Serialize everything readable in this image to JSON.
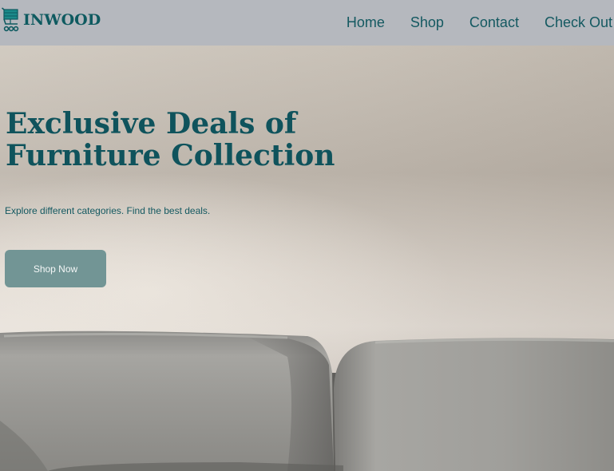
{
  "brand": {
    "name": "INWOOD",
    "icon": "shopping-cart-icon",
    "color": "#0e5a60"
  },
  "nav": {
    "items": [
      {
        "label": "Home"
      },
      {
        "label": "Shop"
      },
      {
        "label": "Contact"
      },
      {
        "label": "Check Out"
      }
    ]
  },
  "hero": {
    "title_line1": "Exclusive Deals of",
    "title_line2": "Furniture Collection",
    "subtitle": "Explore different categories. Find the best deals.",
    "cta_label": "Shop Now",
    "image": "grey-leather-sofa",
    "accent_color": "#729595"
  }
}
